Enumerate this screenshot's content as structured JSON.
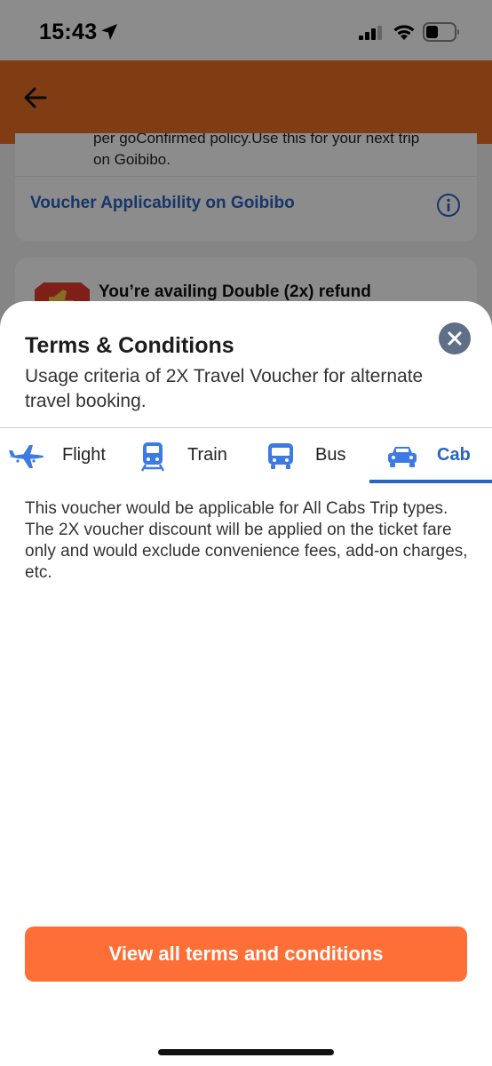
{
  "status_bar": {
    "time": "15:43"
  },
  "background": {
    "card1": {
      "text_lines": [
        "per goConfirmed policy.Use this for your next trip",
        "on Goibibo."
      ],
      "link": "Voucher Applicability on Goibibo"
    },
    "card2": {
      "text": "You’re availing Double (2x) refund"
    }
  },
  "sheet": {
    "title": "Terms & Conditions",
    "subtitle": "Usage criteria of 2X Travel Voucher for alternate travel booking.",
    "tabs": [
      {
        "label": "Flight",
        "icon": "plane-icon",
        "active": false
      },
      {
        "label": "Train",
        "icon": "train-icon",
        "active": false
      },
      {
        "label": "Bus",
        "icon": "bus-icon",
        "active": false
      },
      {
        "label": "Cab",
        "icon": "car-icon",
        "active": true
      }
    ],
    "body": "This voucher would be applicable for All Cabs Trip types. The 2X voucher discount will be applied on the ticket fare only and would exclude convenience fees, add-on charges, etc.",
    "cta": "View all terms and conditions"
  },
  "colors": {
    "header_orange": "#e96d22",
    "link_blue": "#2a63c2",
    "cta_orange": "#fe6f37",
    "close_grey": "#5f6f88"
  }
}
